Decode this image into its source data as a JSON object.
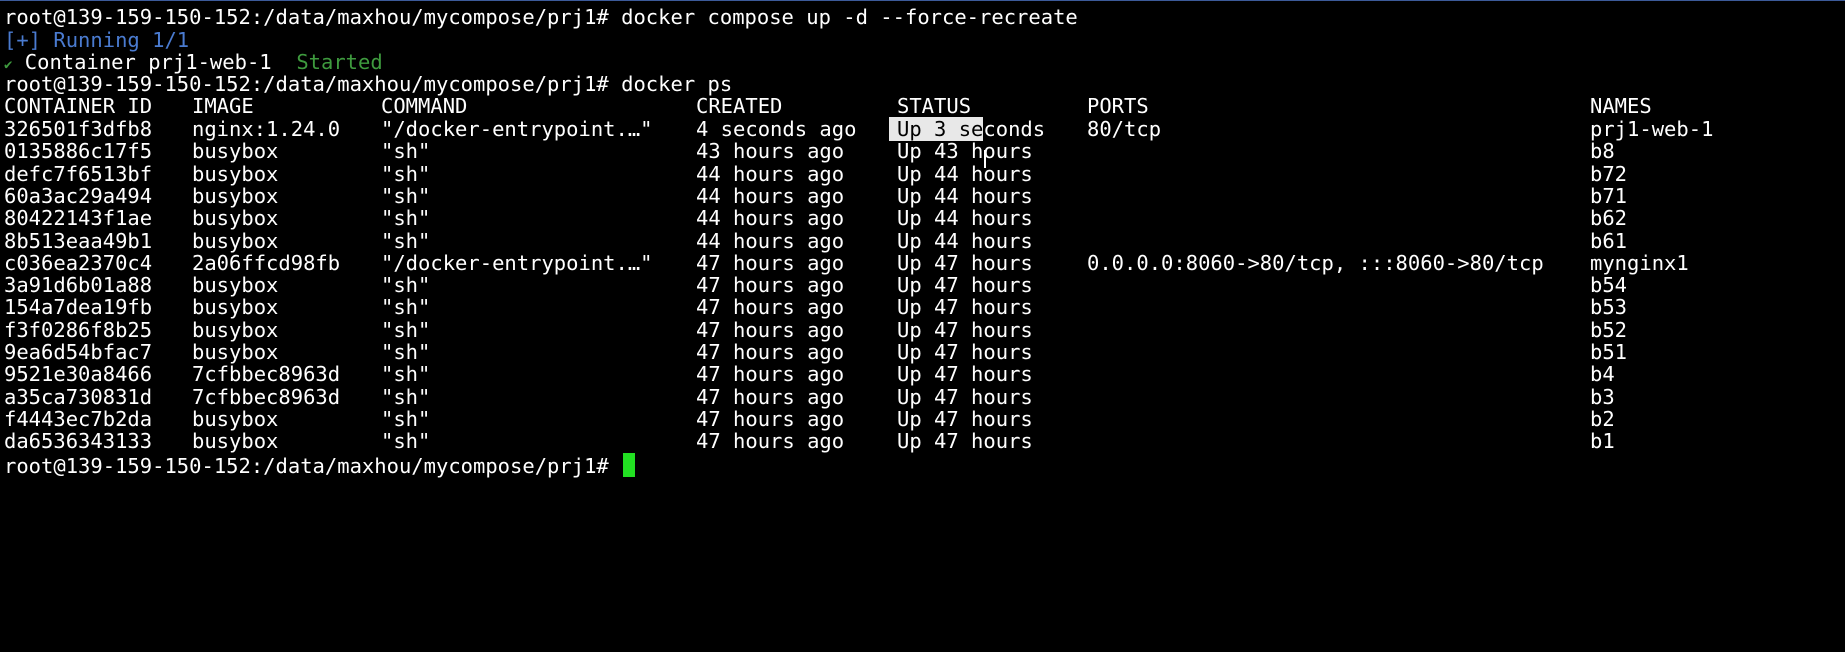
{
  "terminal": {
    "prompt": "root@139-159-150-152:/data/maxhou/mycompose/prj1#",
    "cmd1": "docker compose up -d --force-recreate",
    "running": "[+] Running 1/1",
    "check": "✔",
    "container_text": "Container prj1-web-1",
    "started": "Started",
    "cmd2": "docker ps",
    "headers": {
      "id": "CONTAINER ID",
      "image": "IMAGE",
      "command": "COMMAND",
      "created": "CREATED",
      "status": "STATUS",
      "ports": "PORTS",
      "names": "NAMES"
    },
    "status_selected": "Up 3 se",
    "status_rest": "conds",
    "rows": [
      {
        "id": "326501f3dfb8",
        "image": "nginx:1.24.0",
        "command": "\"/docker-entrypoint.…\"",
        "created": "4 seconds ago",
        "status": "Up 3 seconds",
        "ports": "80/tcp",
        "names": "prj1-web-1"
      },
      {
        "id": "0135886c17f5",
        "image": "busybox",
        "command": "\"sh\"",
        "created": "43 hours ago",
        "status": "Up 43 hours",
        "ports": "",
        "names": "b8"
      },
      {
        "id": "defc7f6513bf",
        "image": "busybox",
        "command": "\"sh\"",
        "created": "44 hours ago",
        "status": "Up 44 hours",
        "ports": "",
        "names": "b72"
      },
      {
        "id": "60a3ac29a494",
        "image": "busybox",
        "command": "\"sh\"",
        "created": "44 hours ago",
        "status": "Up 44 hours",
        "ports": "",
        "names": "b71"
      },
      {
        "id": "80422143f1ae",
        "image": "busybox",
        "command": "\"sh\"",
        "created": "44 hours ago",
        "status": "Up 44 hours",
        "ports": "",
        "names": "b62"
      },
      {
        "id": "8b513eaa49b1",
        "image": "busybox",
        "command": "\"sh\"",
        "created": "44 hours ago",
        "status": "Up 44 hours",
        "ports": "",
        "names": "b61"
      },
      {
        "id": "c036ea2370c4",
        "image": "2a06ffcd98fb",
        "command": "\"/docker-entrypoint.…\"",
        "created": "47 hours ago",
        "status": "Up 47 hours",
        "ports": "0.0.0.0:8060->80/tcp, :::8060->80/tcp",
        "names": "mynginx1"
      },
      {
        "id": "3a91d6b01a88",
        "image": "busybox",
        "command": "\"sh\"",
        "created": "47 hours ago",
        "status": "Up 47 hours",
        "ports": "",
        "names": "b54"
      },
      {
        "id": "154a7dea19fb",
        "image": "busybox",
        "command": "\"sh\"",
        "created": "47 hours ago",
        "status": "Up 47 hours",
        "ports": "",
        "names": "b53"
      },
      {
        "id": "f3f0286f8b25",
        "image": "busybox",
        "command": "\"sh\"",
        "created": "47 hours ago",
        "status": "Up 47 hours",
        "ports": "",
        "names": "b52"
      },
      {
        "id": "9ea6d54bfac7",
        "image": "busybox",
        "command": "\"sh\"",
        "created": "47 hours ago",
        "status": "Up 47 hours",
        "ports": "",
        "names": "b51"
      },
      {
        "id": "9521e30a8466",
        "image": "7cfbbec8963d",
        "command": "\"sh\"",
        "created": "47 hours ago",
        "status": "Up 47 hours",
        "ports": "",
        "names": "b4"
      },
      {
        "id": "a35ca730831d",
        "image": "7cfbbec8963d",
        "command": "\"sh\"",
        "created": "47 hours ago",
        "status": "Up 47 hours",
        "ports": "",
        "names": "b3"
      },
      {
        "id": "f4443ec7b2da",
        "image": "busybox",
        "command": "\"sh\"",
        "created": "47 hours ago",
        "status": "Up 47 hours",
        "ports": "",
        "names": "b2"
      },
      {
        "id": "da6536343133",
        "image": "busybox",
        "command": "\"sh\"",
        "created": "47 hours ago",
        "status": "Up 47 hours",
        "ports": "",
        "names": "b1"
      }
    ]
  },
  "colors": {
    "background": "#000000",
    "foreground": "#ffffff",
    "running_blue": "#4a7bd0",
    "started_green": "#3e9a3e",
    "cursor_green": "#22e022"
  }
}
